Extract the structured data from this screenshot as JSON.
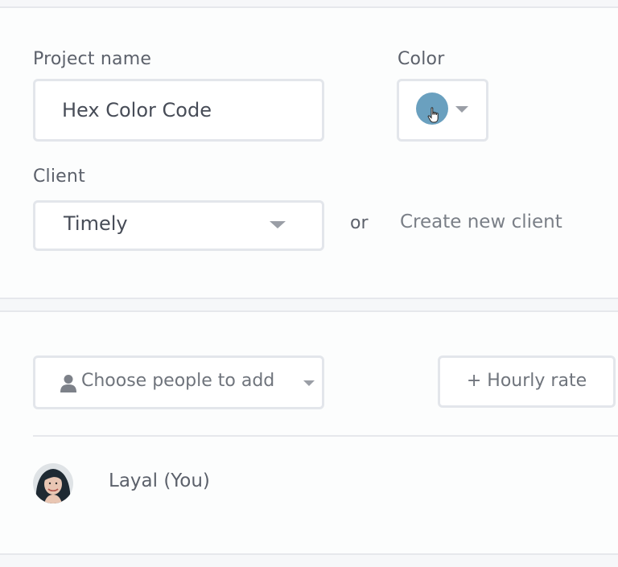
{
  "project": {
    "name_label": "Project name",
    "name_value": "Hex Color Code",
    "color_label": "Color",
    "color_value": "#6aa0bf",
    "color_icon": "chevron-down-icon",
    "client_label": "Client",
    "client_value": "Timely",
    "or_text": "or",
    "create_client_link": "Create new client"
  },
  "people": {
    "choose_placeholder": "Choose people to add",
    "choose_icon": "user-icon",
    "hourly_rate_button": "+ Hourly rate",
    "members": [
      {
        "name": "Layal (You)"
      }
    ]
  },
  "colors": {
    "border": "#e3e6eb",
    "text": "#474c57",
    "muted": "#7a7f87",
    "caret": "#9a9ea6"
  }
}
